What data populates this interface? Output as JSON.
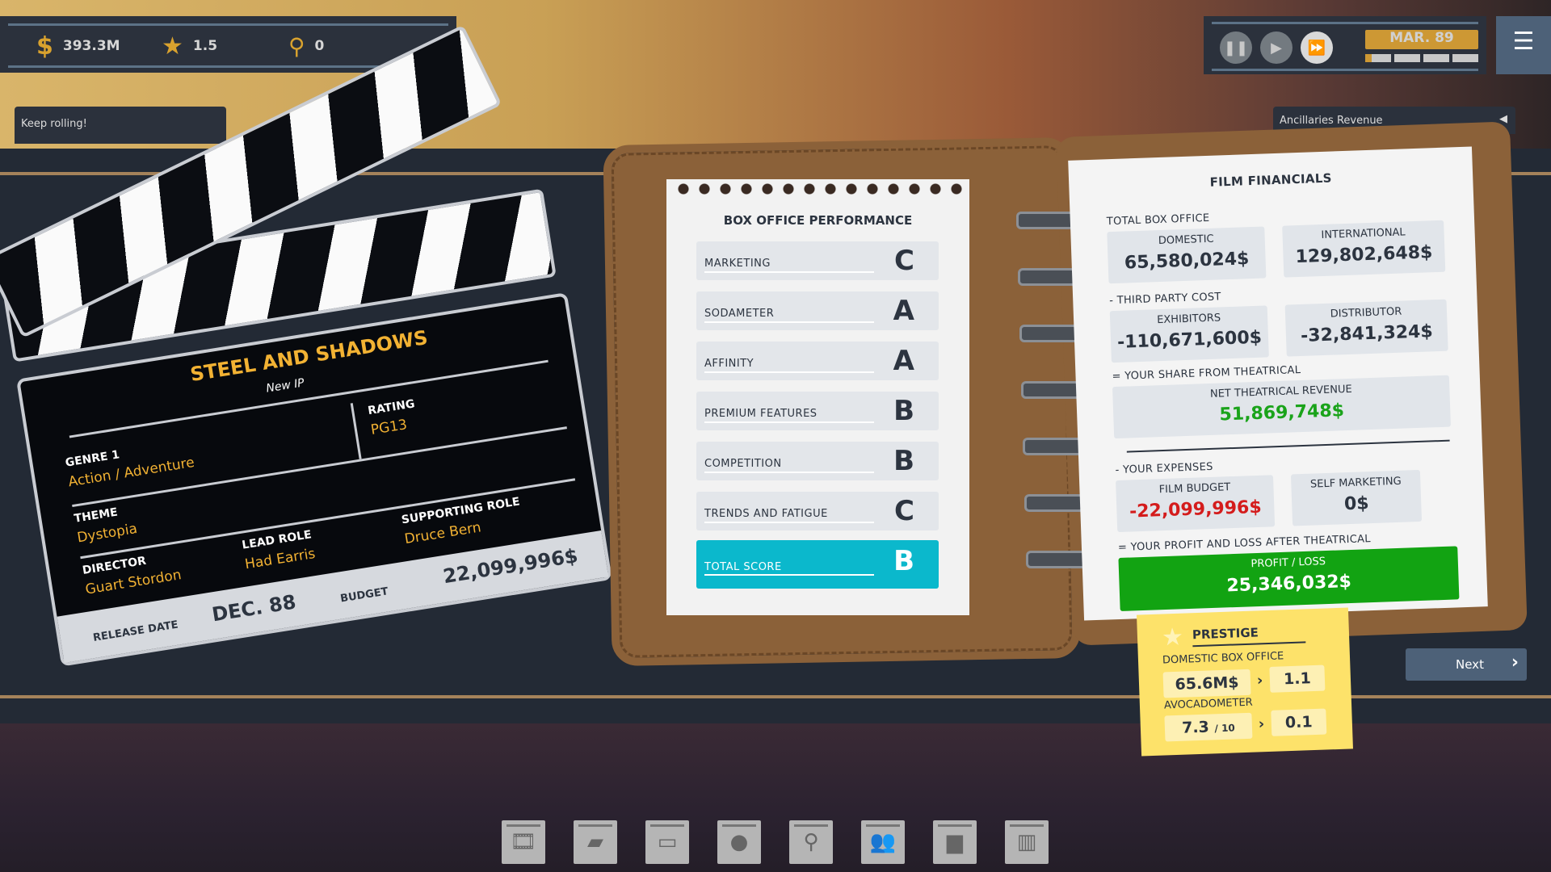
{
  "hud": {
    "money": "393.3M",
    "prestige": "1.5",
    "research": "0",
    "message": "Keep rolling!",
    "date": "MAR. 89",
    "month_progress": 0.06,
    "ancillaries": "Ancillaries Revenue"
  },
  "icons": {
    "money": "dollar-coin-icon",
    "prestige": "star-icon",
    "research": "magnifier-icon",
    "pause": "pause-icon",
    "play": "play-icon",
    "fast": "fast-forward-icon",
    "menu": "hamburger-menu-icon"
  },
  "movie": {
    "title": "STEEL AND SHADOWS",
    "ip": "New IP",
    "genre_label": "GENRE 1",
    "genre": "Action / Adventure",
    "rating_label": "RATING",
    "rating": "PG13",
    "theme_label": "THEME",
    "theme": "Dystopia",
    "director_label": "DIRECTOR",
    "director": "Guart Stordon",
    "lead_label": "LEAD ROLE",
    "lead": "Had Earris",
    "support_label": "SUPPORTING ROLE",
    "support": "Druce Bern",
    "release_label": "RELEASE DATE",
    "release": "DEC. 88",
    "budget_label": "BUDGET",
    "budget": "22,099,996$"
  },
  "boxoffice": {
    "title": "BOX OFFICE PERFORMANCE",
    "rows": [
      {
        "label": "MARKETING",
        "grade": "C"
      },
      {
        "label": "SODAMETER",
        "grade": "A"
      },
      {
        "label": "AFFINITY",
        "grade": "A"
      },
      {
        "label": "PREMIUM FEATURES",
        "grade": "B"
      },
      {
        "label": "COMPETITION",
        "grade": "B"
      },
      {
        "label": "TRENDS AND FATIGUE",
        "grade": "C"
      }
    ],
    "total_label": "TOTAL SCORE",
    "total_grade": "B"
  },
  "financials": {
    "title": "FILM FINANCIALS",
    "total_box": "TOTAL BOX OFFICE",
    "domestic_label": "DOMESTIC",
    "domestic": "65,580,024$",
    "intl_label": "INTERNATIONAL",
    "intl": "129,802,648$",
    "third": "- THIRD PARTY COST",
    "exhib_label": "EXHIBITORS",
    "exhib": "-110,671,600$",
    "dist_label": "DISTRIBUTOR",
    "dist": "-32,841,324$",
    "share": "= YOUR SHARE FROM THEATRICAL",
    "net_label": "NET THEATRICAL REVENUE",
    "net": "51,869,748$",
    "expenses": "- YOUR EXPENSES",
    "fb_label": "FILM BUDGET",
    "fb": "-22,099,996$",
    "sm_label": "SELF MARKETING",
    "sm": "0$",
    "pl_title": "= YOUR PROFIT AND LOSS AFTER THEATRICAL",
    "pl_label": "PROFIT / LOSS",
    "pl": "25,346,032$"
  },
  "prestige": {
    "title": "PRESTIGE",
    "dbo_label": "DOMESTIC BOX OFFICE",
    "dbo": "65.6M$",
    "dbo_gain": "1.1",
    "avo_label": "AVOCADOMETER",
    "avo": "7.3",
    "avo_max": "/ 10",
    "avo_gain": "0.1"
  },
  "next_label": "Next",
  "toolbar": [
    "film-reel-icon",
    "folder-icon",
    "tv-icon",
    "lightbulb-icon",
    "magnifier-icon",
    "people-icon",
    "chart-icon",
    "building-icon"
  ],
  "colors": {
    "gold": "#d9a22e",
    "teal": "#0bb8cc",
    "green": "#1aa31a",
    "red": "#d41c1c"
  }
}
